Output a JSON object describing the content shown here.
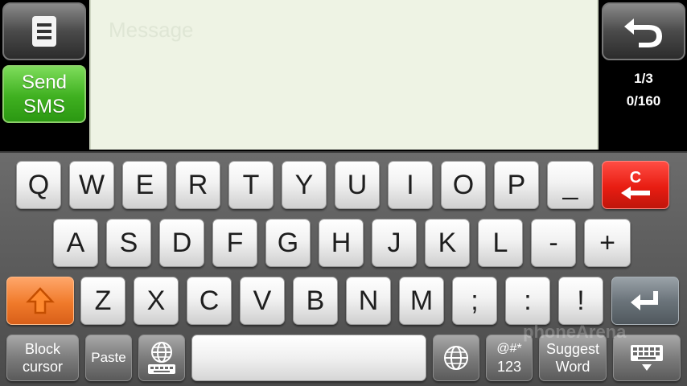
{
  "header": {
    "send_label_line1": "Send",
    "send_label_line2": "SMS",
    "message_placeholder": "Message",
    "page_counter": "1/3",
    "char_counter": "0/160"
  },
  "keyboard": {
    "row1": [
      "Q",
      "W",
      "E",
      "R",
      "T",
      "Y",
      "U",
      "I",
      "O",
      "P",
      "_"
    ],
    "clear_label": "C",
    "row2": [
      "A",
      "S",
      "D",
      "F",
      "G",
      "H",
      "J",
      "K",
      "L",
      "-",
      "+"
    ],
    "row3": [
      "Z",
      "X",
      "C",
      "V",
      "B",
      "N",
      "M",
      ";",
      ":",
      "!"
    ],
    "block_cursor_line1": "Block",
    "block_cursor_line2": "cursor",
    "paste_label": "Paste",
    "symbols_line1": "@#*",
    "symbols_line2": "123",
    "suggest_line1": "Suggest",
    "suggest_line2": "Word"
  },
  "watermark": "phoneArena",
  "colors": {
    "send_green": "#3fb020",
    "clear_red": "#e81d12",
    "shift_orange": "#f07a2a",
    "message_bg": "#eef3e4"
  }
}
